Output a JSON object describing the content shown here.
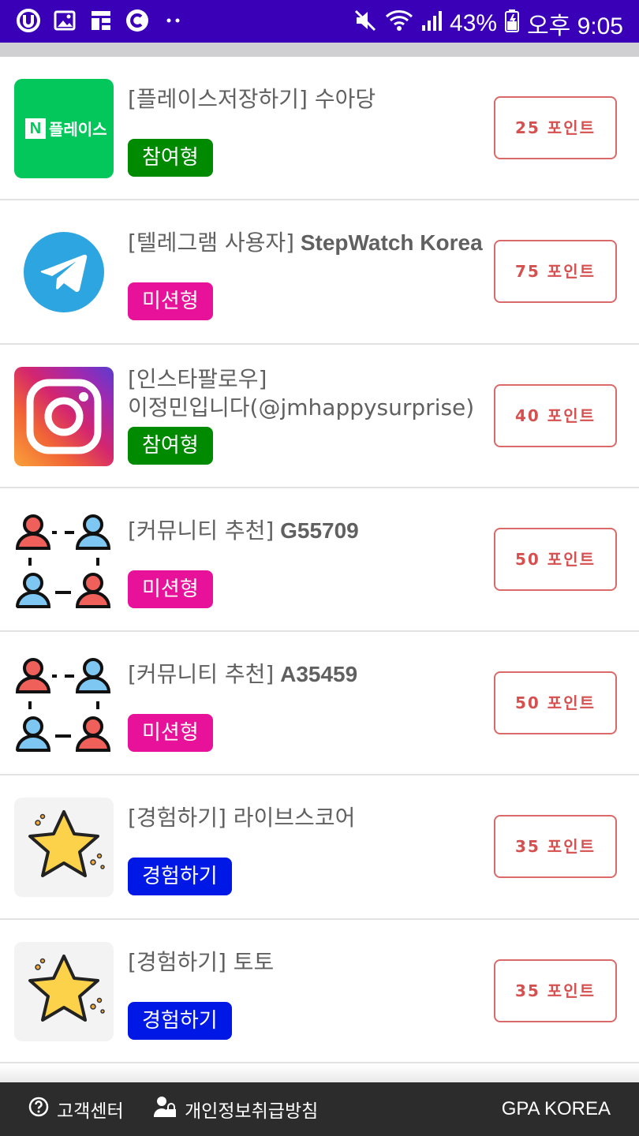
{
  "status_bar": {
    "battery": "43%",
    "time": "오후 9:05",
    "icons": [
      "u-plus-icon",
      "gallery-icon",
      "widget-icon",
      "c-circle-icon",
      "dots-icon",
      "mute-icon",
      "wifi-icon",
      "signal-icon",
      "battery-icon"
    ]
  },
  "items": [
    {
      "title_bracket": "[플레이스저장하기]",
      "title_rest": " 수아당",
      "tag": "참여형",
      "tag_color": "#008a00",
      "points": "25 포인트",
      "thumb": "naver-place-logo",
      "thumb_text": "플레이스",
      "thumb_badge": "N"
    },
    {
      "title_bracket": "[텔레그램 사용자]",
      "title_rest": " StepWatch Korea",
      "tag": "미션형",
      "tag_color": "#e8129a",
      "points": "75 포인트",
      "thumb": "telegram-logo"
    },
    {
      "title_bracket": "[인스타팔로우]",
      "title_rest": "이정민입니다(@jmhappysurprise)",
      "tag": "참여형",
      "tag_color": "#008a00",
      "points": "40 포인트",
      "thumb": "instagram-logo"
    },
    {
      "title_bracket": "[커뮤니티 추천]",
      "title_rest": " G55709",
      "tag": "미션형",
      "tag_color": "#e8129a",
      "points": "50 포인트",
      "thumb": "community-people-icon"
    },
    {
      "title_bracket": "[커뮤니티 추천]",
      "title_rest": " A35459",
      "tag": "미션형",
      "tag_color": "#e8129a",
      "points": "50 포인트",
      "thumb": "community-people-icon"
    },
    {
      "title_bracket": "[경험하기]",
      "title_rest": " 라이브스코어",
      "tag": "경험하기",
      "tag_color": "#0018e6",
      "points": "35 포인트",
      "thumb": "star-icon"
    },
    {
      "title_bracket": "[경험하기]",
      "title_rest": " 토토",
      "tag": "경험하기",
      "tag_color": "#0018e6",
      "points": "35 포인트",
      "thumb": "star-icon"
    }
  ],
  "footer": {
    "support": "고객센터",
    "privacy": "개인정보취급방침",
    "brand": "GPA KOREA",
    "support_icon": "question-circle-icon",
    "privacy_icon": "person-lock-icon"
  }
}
